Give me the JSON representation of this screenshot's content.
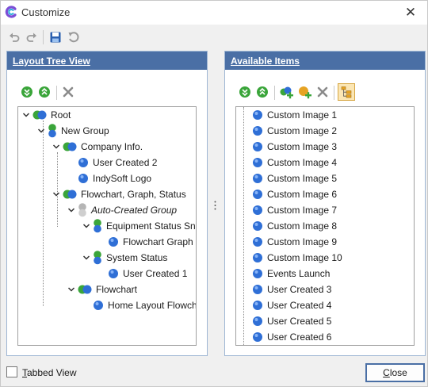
{
  "window": {
    "title": "Customize",
    "close_glyph": "✕"
  },
  "toolbar": {
    "icons": [
      "undo-icon",
      "redo-icon",
      "save-icon",
      "reset-icon"
    ]
  },
  "layout_panel": {
    "header": "Layout Tree View",
    "tools": [
      "expand-all-icon",
      "collapse-all-icon",
      "delete-icon"
    ],
    "tree": [
      {
        "label": "Root",
        "style": "normal"
      },
      {
        "label": "New Group",
        "style": "normal"
      },
      {
        "label": "Company Info.",
        "style": "normal"
      },
      {
        "label": "User Created 2",
        "style": "normal"
      },
      {
        "label": "IndySoft Logo",
        "style": "normal"
      },
      {
        "label": "Flowchart, Graph, Status",
        "style": "normal"
      },
      {
        "label": "Auto-Created Group",
        "style": "italic"
      },
      {
        "label": "Equipment Status Sna",
        "style": "normal"
      },
      {
        "label": "Flowchart Graph",
        "style": "normal"
      },
      {
        "label": "System Status",
        "style": "normal"
      },
      {
        "label": "User Created 1",
        "style": "normal"
      },
      {
        "label": "Flowchart",
        "style": "normal"
      },
      {
        "label": "Home Layout Flowcha",
        "style": "normal"
      }
    ]
  },
  "available_panel": {
    "header": "Available Items",
    "tools": [
      "expand-all-icon",
      "collapse-all-icon",
      "add-group-icon",
      "add-item-icon",
      "delete-icon",
      "tree-view-icon"
    ],
    "items": [
      "Custom Image 1",
      "Custom Image 2",
      "Custom Image 3",
      "Custom Image 4",
      "Custom Image 5",
      "Custom Image 6",
      "Custom Image 7",
      "Custom Image 8",
      "Custom Image 9",
      "Custom Image 10",
      "Events Launch",
      "User Created 3",
      "User Created 4",
      "User Created 5",
      "User Created 6"
    ]
  },
  "footer": {
    "tabbed_view_label": "Tabbed View",
    "tabbed_view_checked": false,
    "close_label": "Close"
  },
  "colors": {
    "header_bg": "#4a6fa5",
    "item_blue": "#2f6fd6",
    "group_green": "#3aa53a",
    "group_gray": "#b5b5b5"
  }
}
